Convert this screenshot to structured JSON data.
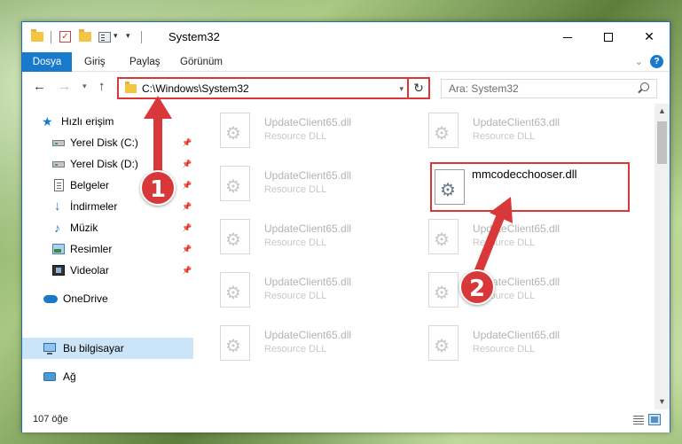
{
  "window": {
    "title": "System32",
    "minimize_icon": "minimize-icon",
    "maximize_icon": "maximize-icon",
    "close_label": "✕"
  },
  "ribbon": {
    "tabs": [
      {
        "label": "Dosya"
      },
      {
        "label": "Giriş"
      },
      {
        "label": "Paylaş"
      },
      {
        "label": "Görünüm"
      }
    ],
    "help_label": "?"
  },
  "navigation": {
    "address_path": "C:\\Windows\\System32",
    "search_placeholder": "Ara: System32"
  },
  "sidebar": {
    "items": [
      {
        "label": "Hızlı erişim",
        "icon": "star-icon",
        "pinned": false
      },
      {
        "label": "Yerel Disk (C:)",
        "icon": "drive-icon",
        "pinned": true
      },
      {
        "label": "Yerel Disk (D:)",
        "icon": "drive-icon",
        "pinned": true
      },
      {
        "label": "Belgeler",
        "icon": "document-icon",
        "pinned": true
      },
      {
        "label": "İndirmeler",
        "icon": "download-icon",
        "pinned": true
      },
      {
        "label": "Müzik",
        "icon": "music-icon",
        "pinned": true
      },
      {
        "label": "Resimler",
        "icon": "pictures-icon",
        "pinned": true
      },
      {
        "label": "Videolar",
        "icon": "video-icon",
        "pinned": true
      },
      {
        "label": "OneDrive",
        "icon": "cloud-icon",
        "pinned": false
      },
      {
        "label": "Bu bilgisayar",
        "icon": "computer-icon",
        "pinned": false,
        "selected": true
      },
      {
        "label": "Ağ",
        "icon": "network-icon",
        "pinned": false
      }
    ]
  },
  "files": [
    {
      "name": "UpdateClient65.dll",
      "desc": "Resource DLL"
    },
    {
      "name": "UpdateClient63.dll",
      "desc": "Resource DLL"
    },
    {
      "name": "UpdateClient65.dll",
      "desc": "Resource DLL"
    },
    {
      "name": "mmcodecchooser.dll",
      "desc": ""
    },
    {
      "name": "UpdateClient65.dll",
      "desc": "Resource DLL"
    },
    {
      "name": "UpdateClient65.dll",
      "desc": "Resource DLL"
    },
    {
      "name": "UpdateClient65.dll",
      "desc": "Resource DLL"
    },
    {
      "name": "UpdateClient65.dll",
      "desc": "Resource DLL"
    },
    {
      "name": "UpdateClient65.dll",
      "desc": "Resource DLL"
    },
    {
      "name": "UpdateClient65.dll",
      "desc": "Resource DLL"
    }
  ],
  "status": {
    "item_count": "107 öğe"
  },
  "annotations": {
    "step1": "1",
    "step2": "2",
    "color": "#d9383a"
  }
}
